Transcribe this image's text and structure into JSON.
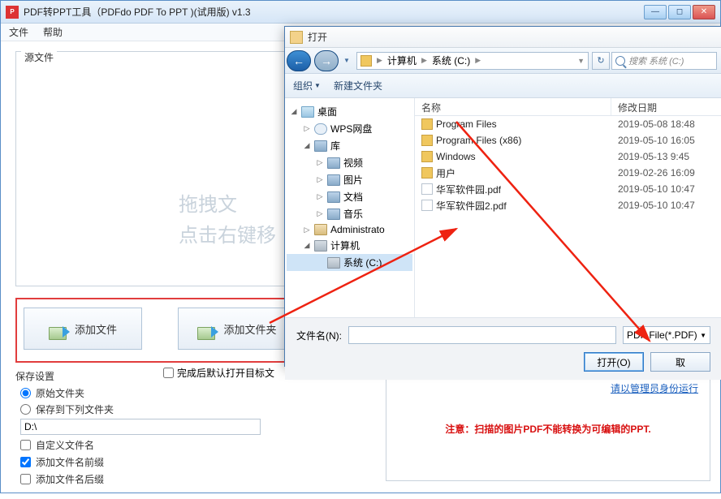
{
  "mainWindow": {
    "title": "PDF转PPT工具（PDFdo PDF To PPT )(试用版) v1.3",
    "menu": {
      "file": "文件",
      "help": "帮助"
    },
    "sourceLabel": "源文件",
    "dragHint1": "拖拽文",
    "dragHint2": "点击右键移",
    "addFileBtn": "添加文件",
    "addFolderBtn": "添加文件夹",
    "completeCheck": "完成后默认打开目标文",
    "save": {
      "title": "保存设置",
      "opt1": "原始文件夹",
      "opt2": "保存到下列文件夹",
      "path": "D:\\",
      "chk1": "自定义文件名",
      "chk2": "添加文件名前缀",
      "chk3": "添加文件名后缀"
    },
    "adminLink": "请以管理员身份运行",
    "warning": "注意：扫描的图片PDF不能转换为可编辑的PPT."
  },
  "dialog": {
    "title": "打开",
    "breadcrumb": {
      "item1": "计算机",
      "item2": "系统 (C:)"
    },
    "searchPlaceholder": "搜索 系统 (C:)",
    "toolbar": {
      "org": "组织",
      "newFolder": "新建文件夹"
    },
    "tree": [
      {
        "exp": "◢",
        "indent": 0,
        "icon": "desk",
        "label": "桌面"
      },
      {
        "exp": "▷",
        "indent": 1,
        "icon": "cloud",
        "label": "WPS网盘"
      },
      {
        "exp": "◢",
        "indent": 1,
        "icon": "lib",
        "label": "库"
      },
      {
        "exp": "▷",
        "indent": 2,
        "icon": "lib",
        "label": "视频"
      },
      {
        "exp": "▷",
        "indent": 2,
        "icon": "lib",
        "label": "图片"
      },
      {
        "exp": "▷",
        "indent": 2,
        "icon": "lib",
        "label": "文档"
      },
      {
        "exp": "▷",
        "indent": 2,
        "icon": "lib",
        "label": "音乐"
      },
      {
        "exp": "▷",
        "indent": 1,
        "icon": "user",
        "label": "Administrato"
      },
      {
        "exp": "◢",
        "indent": 1,
        "icon": "drive",
        "label": "计算机"
      },
      {
        "exp": "",
        "indent": 2,
        "icon": "drive",
        "label": "系统 (C:)",
        "sel": true
      }
    ],
    "listHead": {
      "name": "名称",
      "date": "修改日期"
    },
    "files": [
      {
        "icon": "folder",
        "name": "Program Files",
        "date": "2019-05-08 18:48"
      },
      {
        "icon": "folder",
        "name": "Program Files (x86)",
        "date": "2019-05-10 16:05"
      },
      {
        "icon": "folder",
        "name": "Windows",
        "date": "2019-05-13 9:45"
      },
      {
        "icon": "folder",
        "name": "用户",
        "date": "2019-02-26 16:09"
      },
      {
        "icon": "pdf",
        "name": "华军软件园.pdf",
        "date": "2019-05-10 10:47"
      },
      {
        "icon": "pdf",
        "name": "华军软件园2.pdf",
        "date": "2019-05-10 10:47"
      }
    ],
    "fnLabel": "文件名(N):",
    "fileType": "PDF File(*.PDF)",
    "openBtn": "打开(O)",
    "cancelBtn": "取"
  }
}
